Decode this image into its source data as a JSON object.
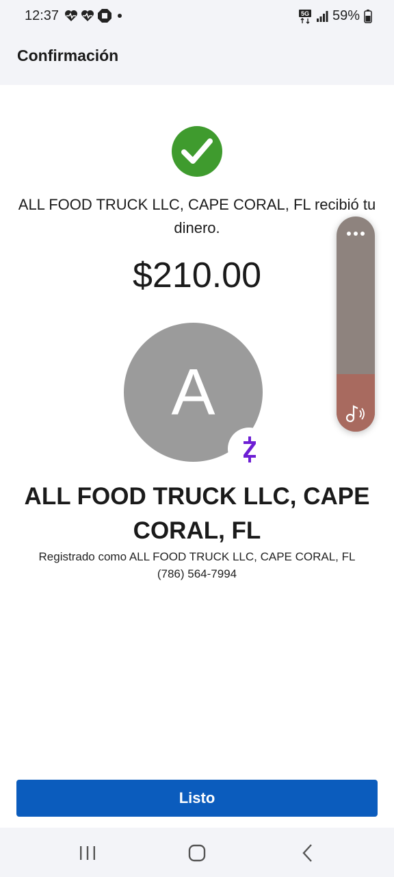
{
  "status_bar": {
    "time": "12:37",
    "battery": "59%",
    "network": "5G",
    "icons_left": [
      "heartbeat-icon",
      "heartbeat-icon",
      "chase-icon",
      "dot-icon"
    ]
  },
  "header": {
    "title": "Confirmación"
  },
  "confirmation": {
    "message": "ALL FOOD TRUCK LLC, CAPE CORAL, FL recibió tu dinero.",
    "amount": "$210.00"
  },
  "recipient": {
    "avatar_letter": "A",
    "name": "ALL FOOD TRUCK LLC, CAPE CORAL, FL",
    "registered": "Registrado como ALL FOOD TRUCK LLC, CAPE CORAL, FL",
    "phone": "(786) 564-7994"
  },
  "actions": {
    "done_label": "Listo"
  },
  "colors": {
    "success_green": "#3f9b2e",
    "primary_blue": "#0b5cbd",
    "zelle_purple": "#6d1ed4",
    "avatar_gray": "#9b9b9b"
  }
}
